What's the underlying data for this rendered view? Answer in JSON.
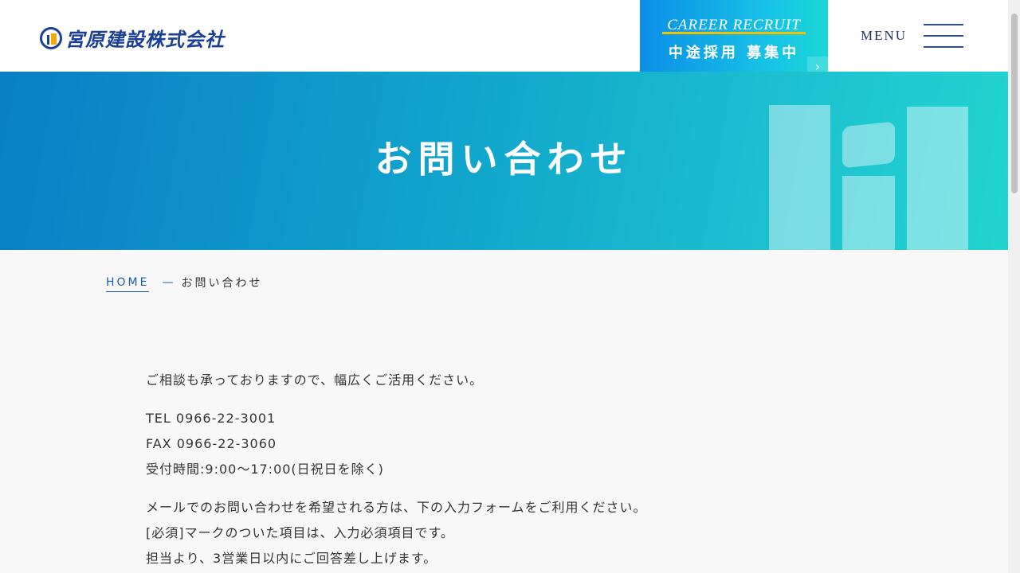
{
  "header": {
    "logo_text": "宮原建設株式会社",
    "recruit": {
      "en": "CAREER RECRUIT",
      "ja": "中途採用 募集中",
      "arrow": "›"
    },
    "menu_label": "MENU"
  },
  "hero": {
    "title": "お問い合わせ"
  },
  "breadcrumb": {
    "home": "HOME",
    "separator": "—",
    "current": "お問い合わせ"
  },
  "content": {
    "intro": "ご相談も承っておりますので、幅広くご活用ください。",
    "tel": "TEL 0966-22-3001",
    "fax": "FAX 0966-22-3060",
    "hours": "受付時間:9:00〜17:00(日祝日を除く)",
    "mail_note": "メールでのお問い合わせを希望される方は、下の入力フォームをご利用ください。",
    "required_note": "[必須]マークのついた項目は、入力必須項目です。",
    "reply_note": "担当より、3営業日以内にご回答差し上げます。"
  },
  "colors": {
    "brand": "#1b3f94",
    "accent_yellow": "#f2c200",
    "hero_start": "#0a7ec6",
    "hero_end": "#22d4cf",
    "link": "#1c5fa4"
  },
  "icons": {
    "logo": "company-logo-icon",
    "menu": "hamburger-icon",
    "recruit_arrow": "chevron-right-icon"
  }
}
